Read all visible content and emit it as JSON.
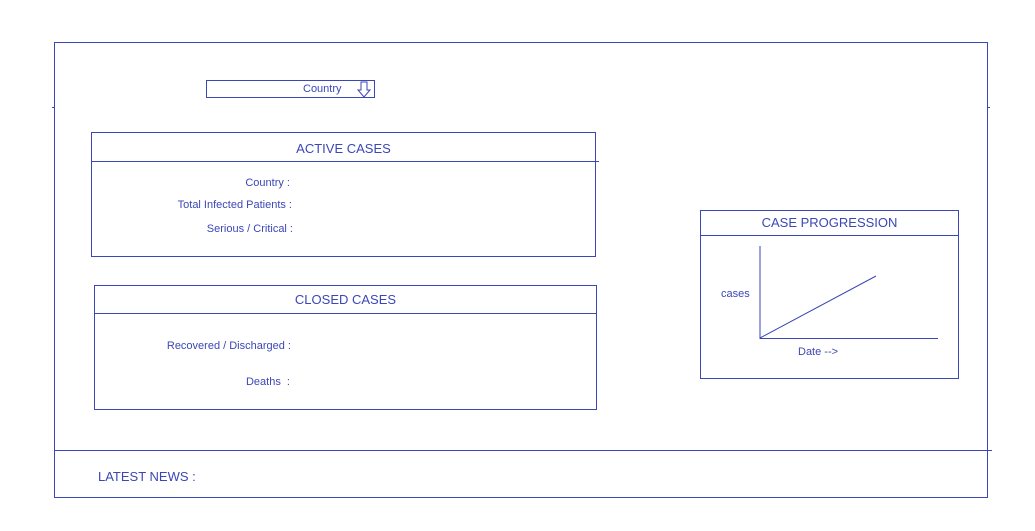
{
  "country_select": {
    "selected": "Country",
    "icon": "arrow-down-icon"
  },
  "active_cases": {
    "title": "ACTIVE CASES",
    "fields": [
      "Country :",
      "Total Infected Patients :",
      "Serious / Critical :"
    ]
  },
  "closed_cases": {
    "title": "CLOSED CASES",
    "fields": [
      "Recovered / Discharged :",
      "Deaths  :"
    ]
  },
  "case_progression": {
    "title": "CASE PROGRESSION",
    "y_label": "cases",
    "x_label": "Date -->"
  },
  "news": {
    "label": "LATEST NEWS :"
  },
  "colors": {
    "accent": "#3b47b5",
    "background": "#ffffff"
  }
}
